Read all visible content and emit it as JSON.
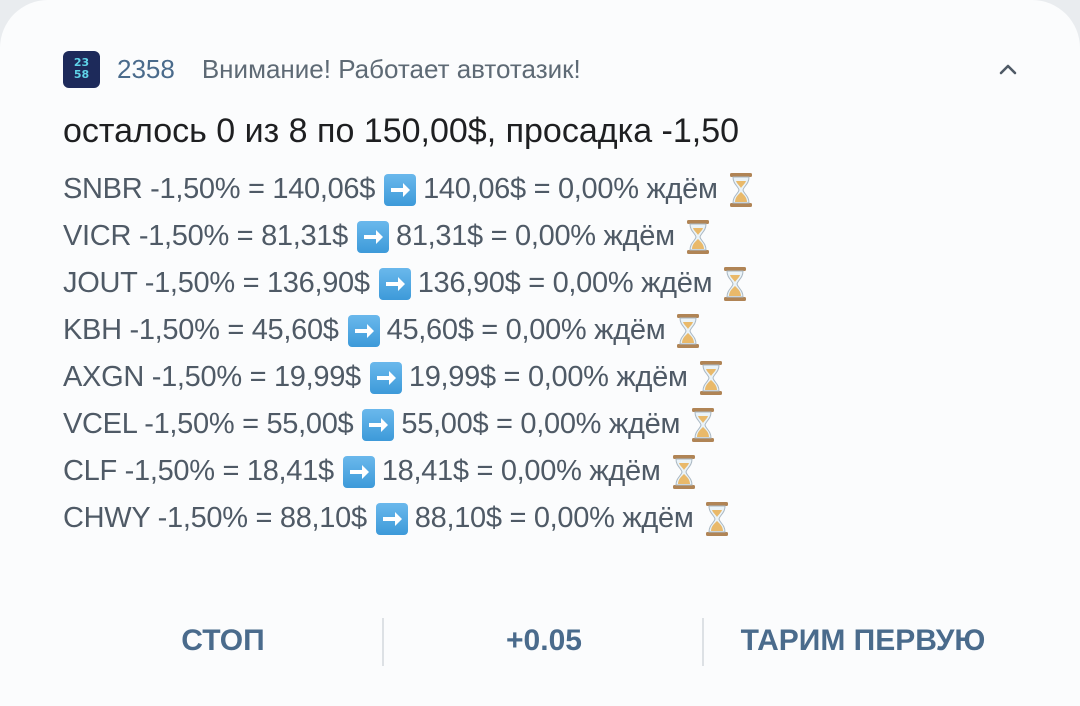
{
  "header": {
    "app_icon_line1": "23",
    "app_icon_line2": "58",
    "app_name": "2358",
    "title": "Внимание! Работает автотазик!",
    "expand_icon": "chevron-up-icon"
  },
  "headline": "осталось 0 из 8 по 150,00$, просадка -1,50",
  "rows": [
    {
      "left": "SNBR -1,50% = 140,06$",
      "right": "140,06$ = 0,00% ждём"
    },
    {
      "left": "VICR -1,50% = 81,31$",
      "right": "81,31$ = 0,00% ждём"
    },
    {
      "left": "JOUT -1,50% = 136,90$",
      "right": "136,90$ = 0,00% ждём"
    },
    {
      "left": "KBH -1,50% = 45,60$",
      "right": "45,60$ = 0,00% ждём"
    },
    {
      "left": "AXGN -1,50% = 19,99$",
      "right": "19,99$ = 0,00% ждём"
    },
    {
      "left": "VCEL -1,50% = 55,00$",
      "right": "55,00$ = 0,00% ждём"
    },
    {
      "left": "CLF -1,50% = 18,41$",
      "right": "18,41$ = 0,00% ждём"
    },
    {
      "left": "CHWY -1,50% = 88,10$",
      "right": "88,10$ = 0,00% ждём"
    }
  ],
  "row_icons": {
    "arrow": "right-arrow-emoji-icon",
    "hourglass": "hourglass-emoji-icon"
  },
  "actions": {
    "stop": "СТОП",
    "plus": "+0.05",
    "first": "ТАРИМ ПЕРВУЮ"
  },
  "colors": {
    "accent": "#4a6b8c",
    "background": "#fbfcfd",
    "headline": "#1e1f21",
    "body_text": "#4f5a66",
    "arrow_emoji": "#3d9ad9"
  }
}
